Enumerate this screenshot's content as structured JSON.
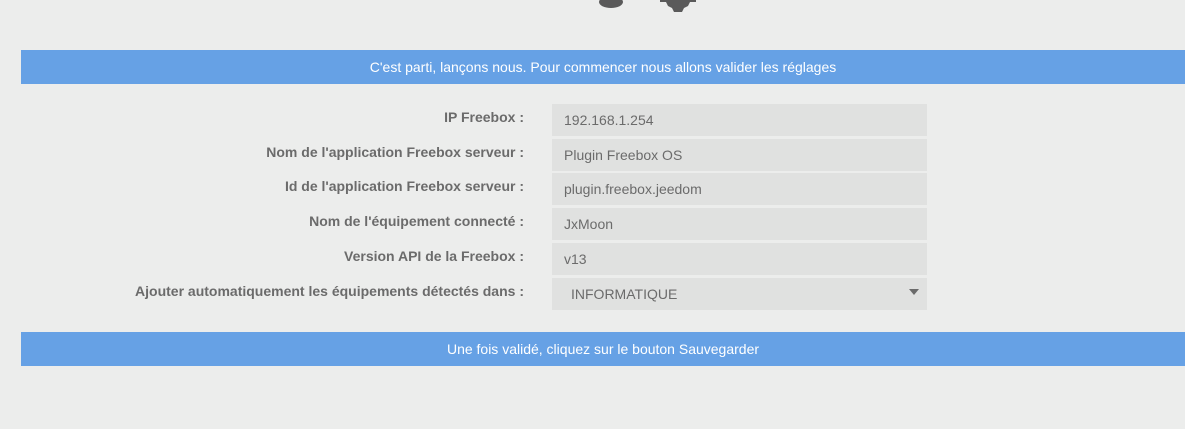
{
  "header_icons": [
    "database-icon",
    "gear-icon"
  ],
  "banner_top": {
    "text": "C'est parti, lançons nous. Pour commencer nous allons valider les réglages"
  },
  "form": {
    "fields": [
      {
        "label": "IP Freebox :",
        "value": "192.168.1.254"
      },
      {
        "label": "Nom de l'application Freebox serveur :",
        "value": "Plugin Freebox OS"
      },
      {
        "label": "Id de l'application Freebox serveur :",
        "value": "plugin.freebox.jeedom"
      },
      {
        "label": "Nom de l'équipement connecté :",
        "value": "JxMoon"
      },
      {
        "label": "Version API de la Freebox :",
        "value": "v13"
      }
    ],
    "select": {
      "label": "Ajouter automatiquement les équipements détectés dans :",
      "selected": "INFORMATIQUE"
    }
  },
  "banner_bottom": {
    "text": "Une fois validé, cliquez sur le bouton Sauvegarder"
  }
}
